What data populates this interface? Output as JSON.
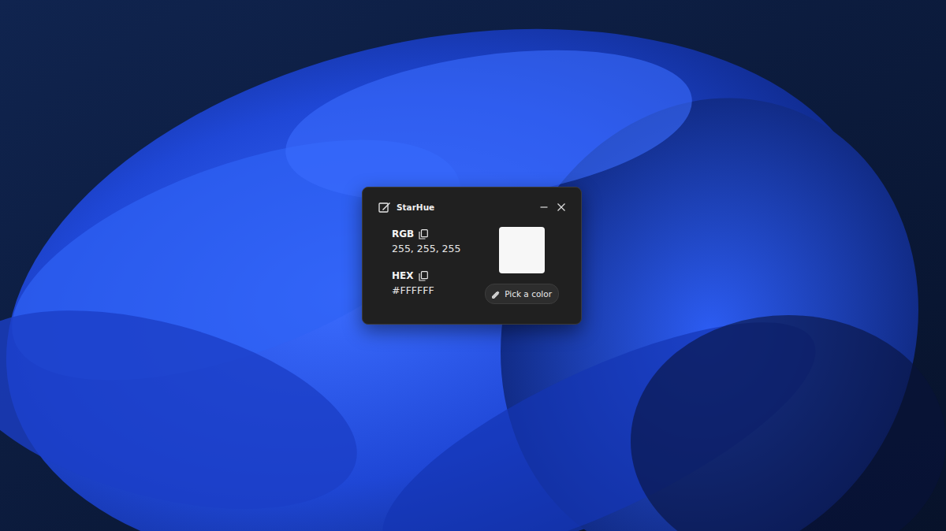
{
  "window": {
    "title": "StarHue"
  },
  "fields": [
    {
      "label": "RGB",
      "value": "255, 255, 255"
    },
    {
      "label": "HEX",
      "value": "#FFFFFF"
    }
  ],
  "swatch": {
    "color": "#F7F7F7"
  },
  "button": {
    "label": "Pick a color"
  }
}
